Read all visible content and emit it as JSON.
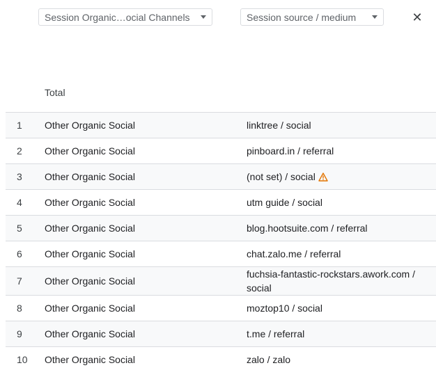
{
  "header": {
    "dimension1_label": "Session Organic…ocial Channels",
    "dimension2_label": "Session source / medium",
    "close_glyph": "✕"
  },
  "total_label": "Total",
  "rows": [
    {
      "index": "1",
      "channel": "Other Organic Social",
      "source": "linktree / social"
    },
    {
      "index": "2",
      "channel": "Other Organic Social",
      "source": "pinboard.in / referral"
    },
    {
      "index": "3",
      "channel": "Other Organic Social",
      "source": "(not set) / social",
      "warning": true
    },
    {
      "index": "4",
      "channel": "Other Organic Social",
      "source": "utm guide / social"
    },
    {
      "index": "5",
      "channel": "Other Organic Social",
      "source": "blog.hootsuite.com / referral"
    },
    {
      "index": "6",
      "channel": "Other Organic Social",
      "source": "chat.zalo.me / referral"
    },
    {
      "index": "7",
      "channel": "Other Organic Social",
      "source": "fuchsia-fantastic-rockstars.awork.com / social"
    },
    {
      "index": "8",
      "channel": "Other Organic Social",
      "source": "moztop10 / social"
    },
    {
      "index": "9",
      "channel": "Other Organic Social",
      "source": "t.me / referral"
    },
    {
      "index": "10",
      "channel": "Other Organic Social",
      "source": "zalo / zalo"
    }
  ],
  "colors": {
    "warning": "#e37400",
    "row_stripe": "#f8f9fa",
    "divider": "#dadce0"
  },
  "icons": {
    "warning": "warning-triangle-icon",
    "dropdown": "chevron-down-icon",
    "close": "close-icon"
  }
}
